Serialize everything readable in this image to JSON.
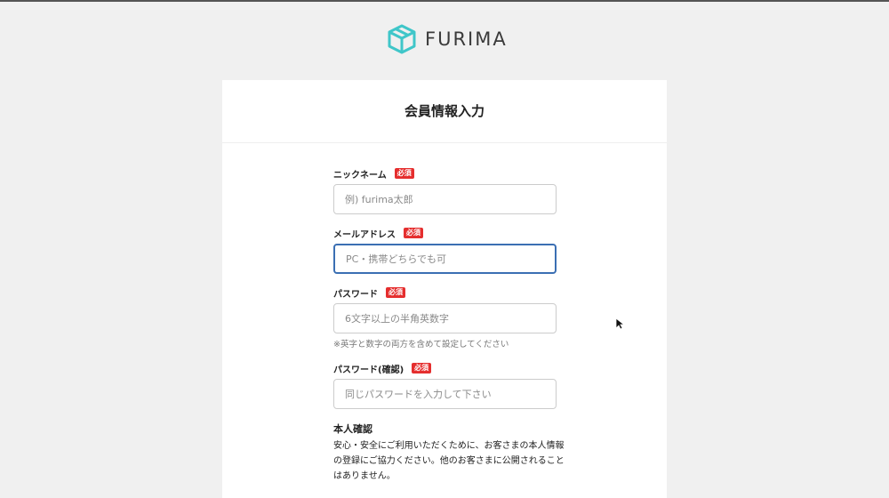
{
  "brand": {
    "name": "FURIMA"
  },
  "page": {
    "title": "会員情報入力"
  },
  "form": {
    "nickname": {
      "label": "ニックネーム",
      "required": "必須",
      "placeholder": "例) furima太郎"
    },
    "email": {
      "label": "メールアドレス",
      "required": "必須",
      "placeholder": "PC・携帯どちらでも可"
    },
    "password": {
      "label": "パスワード",
      "required": "必須",
      "placeholder": "6文字以上の半角英数字",
      "note": "※英字と数字の両方を含めて設定してください"
    },
    "password_confirm": {
      "label": "パスワード(確認)",
      "required": "必須",
      "placeholder": "同じパスワードを入力して下さい"
    }
  },
  "identity": {
    "title": "本人確認",
    "text": "安心・安全にご利用いただくために、お客さまの本人情報の登録にご協力ください。他のお客さまに公開されることはありません。"
  },
  "colors": {
    "brand_teal": "#3fc6c9",
    "required_red": "#e52e2e",
    "focus_blue": "#3b6fb3"
  }
}
